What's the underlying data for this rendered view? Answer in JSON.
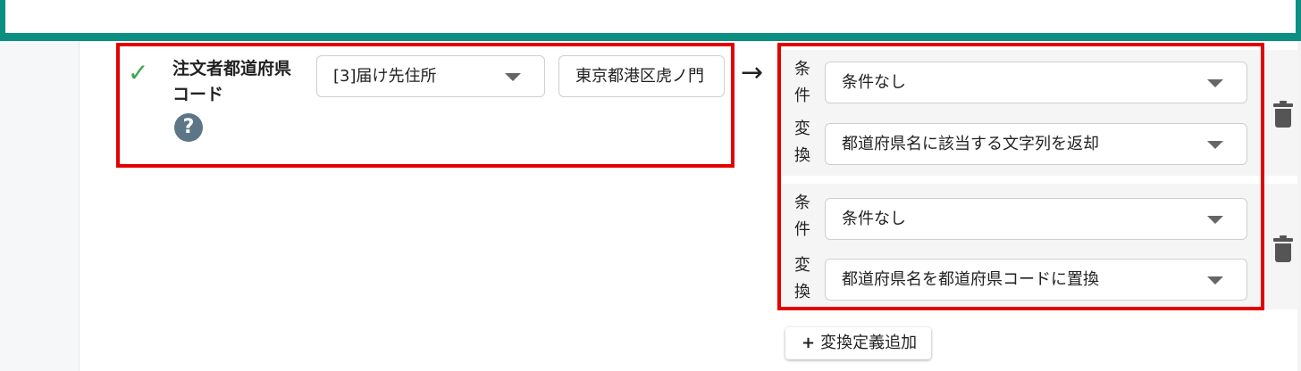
{
  "header": {},
  "mapping_row": {
    "field_name": "注文者都道府県コード",
    "help_label": "?",
    "source_select": "[3]届け先住所",
    "sample_value": "東京都港区虎ノ門"
  },
  "arrow": "→",
  "conversions": [
    {
      "condition_label": [
        "条",
        "件"
      ],
      "condition_value": "条件なし",
      "transform_label": [
        "変",
        "換"
      ],
      "transform_value": "都道府県名に該当する文字列を返却"
    },
    {
      "condition_label": [
        "条",
        "件"
      ],
      "condition_value": "条件なし",
      "transform_label": [
        "変",
        "換"
      ],
      "transform_value": "都道府県名を都道府県コードに置換"
    }
  ],
  "add_button": {
    "plus": "+",
    "label": "変換定義追加"
  },
  "colors": {
    "accent": "#0a8f82",
    "highlight": "#e30000",
    "check": "#3aa54a",
    "help": "#5d7687"
  },
  "icons": {
    "check": "check-icon",
    "help": "question-icon",
    "delete": "trash-icon",
    "dropdown": "caret-down-icon",
    "arrow": "arrow-right-icon"
  }
}
